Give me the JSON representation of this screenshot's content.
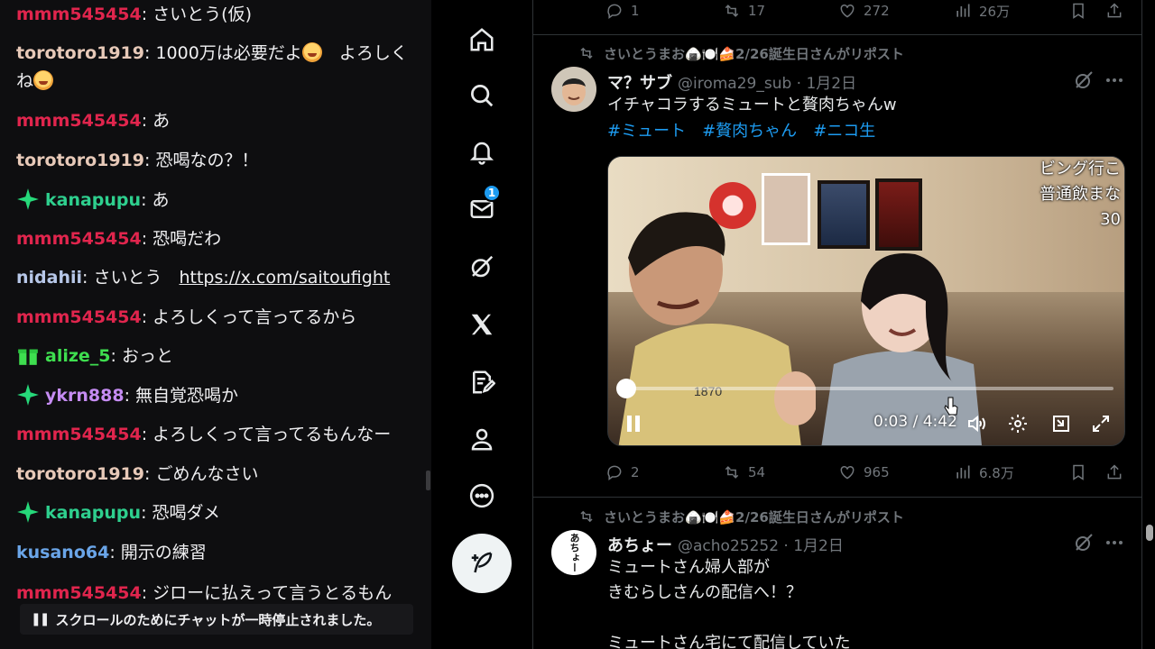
{
  "chat": {
    "messages": [
      {
        "user": "mmm545454",
        "text": "さいとう(仮)",
        "color": "#e0254d",
        "badge": "none"
      },
      {
        "user": "torotoro1919",
        "text": "1000万は必要だよ",
        "text2": "　よろしくね",
        "color": "#e7c9b8",
        "badge": "none"
      },
      {
        "user": "mmm545454",
        "text": "あ",
        "color": "#e0254d",
        "badge": "none"
      },
      {
        "user": "torotoro1919",
        "text": "恐喝なの？！",
        "color": "#e7c9b8",
        "badge": "none"
      },
      {
        "user": "kanapupu",
        "text": "あ",
        "color": "#2ecf8e",
        "badge": "sparkle-icon"
      },
      {
        "user": "mmm545454",
        "text": "恐喝だわ",
        "color": "#e0254d",
        "badge": "none"
      },
      {
        "user": "nidahii",
        "text": "さいとう　",
        "link": "https://x.com/saitoufight",
        "color": "#b7c7e8",
        "badge": "none"
      },
      {
        "user": "mmm545454",
        "text": "よろしくって言ってるから",
        "color": "#e0254d",
        "badge": "none"
      },
      {
        "user": "alize_5",
        "text": "おっと",
        "color": "#3ede4f",
        "badge": "gift-icon"
      },
      {
        "user": "ykrn888",
        "text": "無自覚恐喝か",
        "color": "#c58cf2",
        "badge": "sparkle-icon"
      },
      {
        "user": "mmm545454",
        "text": "よろしくって言ってるもんなー",
        "color": "#e0254d",
        "badge": "none"
      },
      {
        "user": "torotoro1919",
        "text": "ごめんなさい",
        "color": "#e7c9b8",
        "badge": "none"
      },
      {
        "user": "kanapupu",
        "text": "恐喝ダメ",
        "color": "#2ecf8e",
        "badge": "sparkle-icon"
      },
      {
        "user": "kusano64",
        "text": "開示の練習",
        "color": "#6aa5e8",
        "badge": "none"
      },
      {
        "user": "mmm545454",
        "text": "ジローに払えって言うとるもん",
        "color": "#e0254d",
        "badge": "none"
      }
    ],
    "paused_notice": "スクロールのためにチャットが一時停止されました。"
  },
  "nav": {
    "items": [
      {
        "name": "home-icon"
      },
      {
        "name": "search-icon"
      },
      {
        "name": "notifications-icon"
      },
      {
        "name": "messages-icon",
        "badge": "1"
      },
      {
        "name": "grok-icon"
      },
      {
        "name": "x-logo-icon"
      },
      {
        "name": "lists-icon"
      },
      {
        "name": "profile-icon"
      },
      {
        "name": "more-icon"
      }
    ],
    "post_button": "compose-icon"
  },
  "timeline": {
    "top_actions": {
      "replies": "1",
      "reposts": "17",
      "likes": "272",
      "views": "26万"
    },
    "tweets": [
      {
        "repost_by": "さいとうまお🍙🍽️🍰2/26誕生日さんがリポスト",
        "display_name": "マ？サブ",
        "handle": "@iroma29_sub · 1月2日",
        "text": "イチャコラするミュートと贅肉ちゃんw",
        "hashtags": [
          "#ミュート",
          "#贅肉ちゃん",
          "#ニコ生"
        ],
        "video": {
          "overlay_line1": "ビング行こ",
          "overlay_line2": "普通飲まな",
          "overlay_line3": "30",
          "current_time": "0:03",
          "duration": "4:42",
          "time_display": "0:03 / 4:42",
          "progress": 0.011
        },
        "actions": {
          "replies": "2",
          "reposts": "54",
          "likes": "965",
          "views": "6.8万"
        }
      },
      {
        "repost_by": "さいとうまお🍙🍽️🍰2/26誕生日さんがリポスト",
        "display_name": "あちょー",
        "handle": "@acho25252 · 1月2日",
        "avatar_text": "あちょー",
        "text_lines": [
          "ミュートさん婦人部が",
          "きむらしさんの配信へ！？",
          "",
          "ミュートさん宅にて配信していた"
        ]
      }
    ]
  }
}
